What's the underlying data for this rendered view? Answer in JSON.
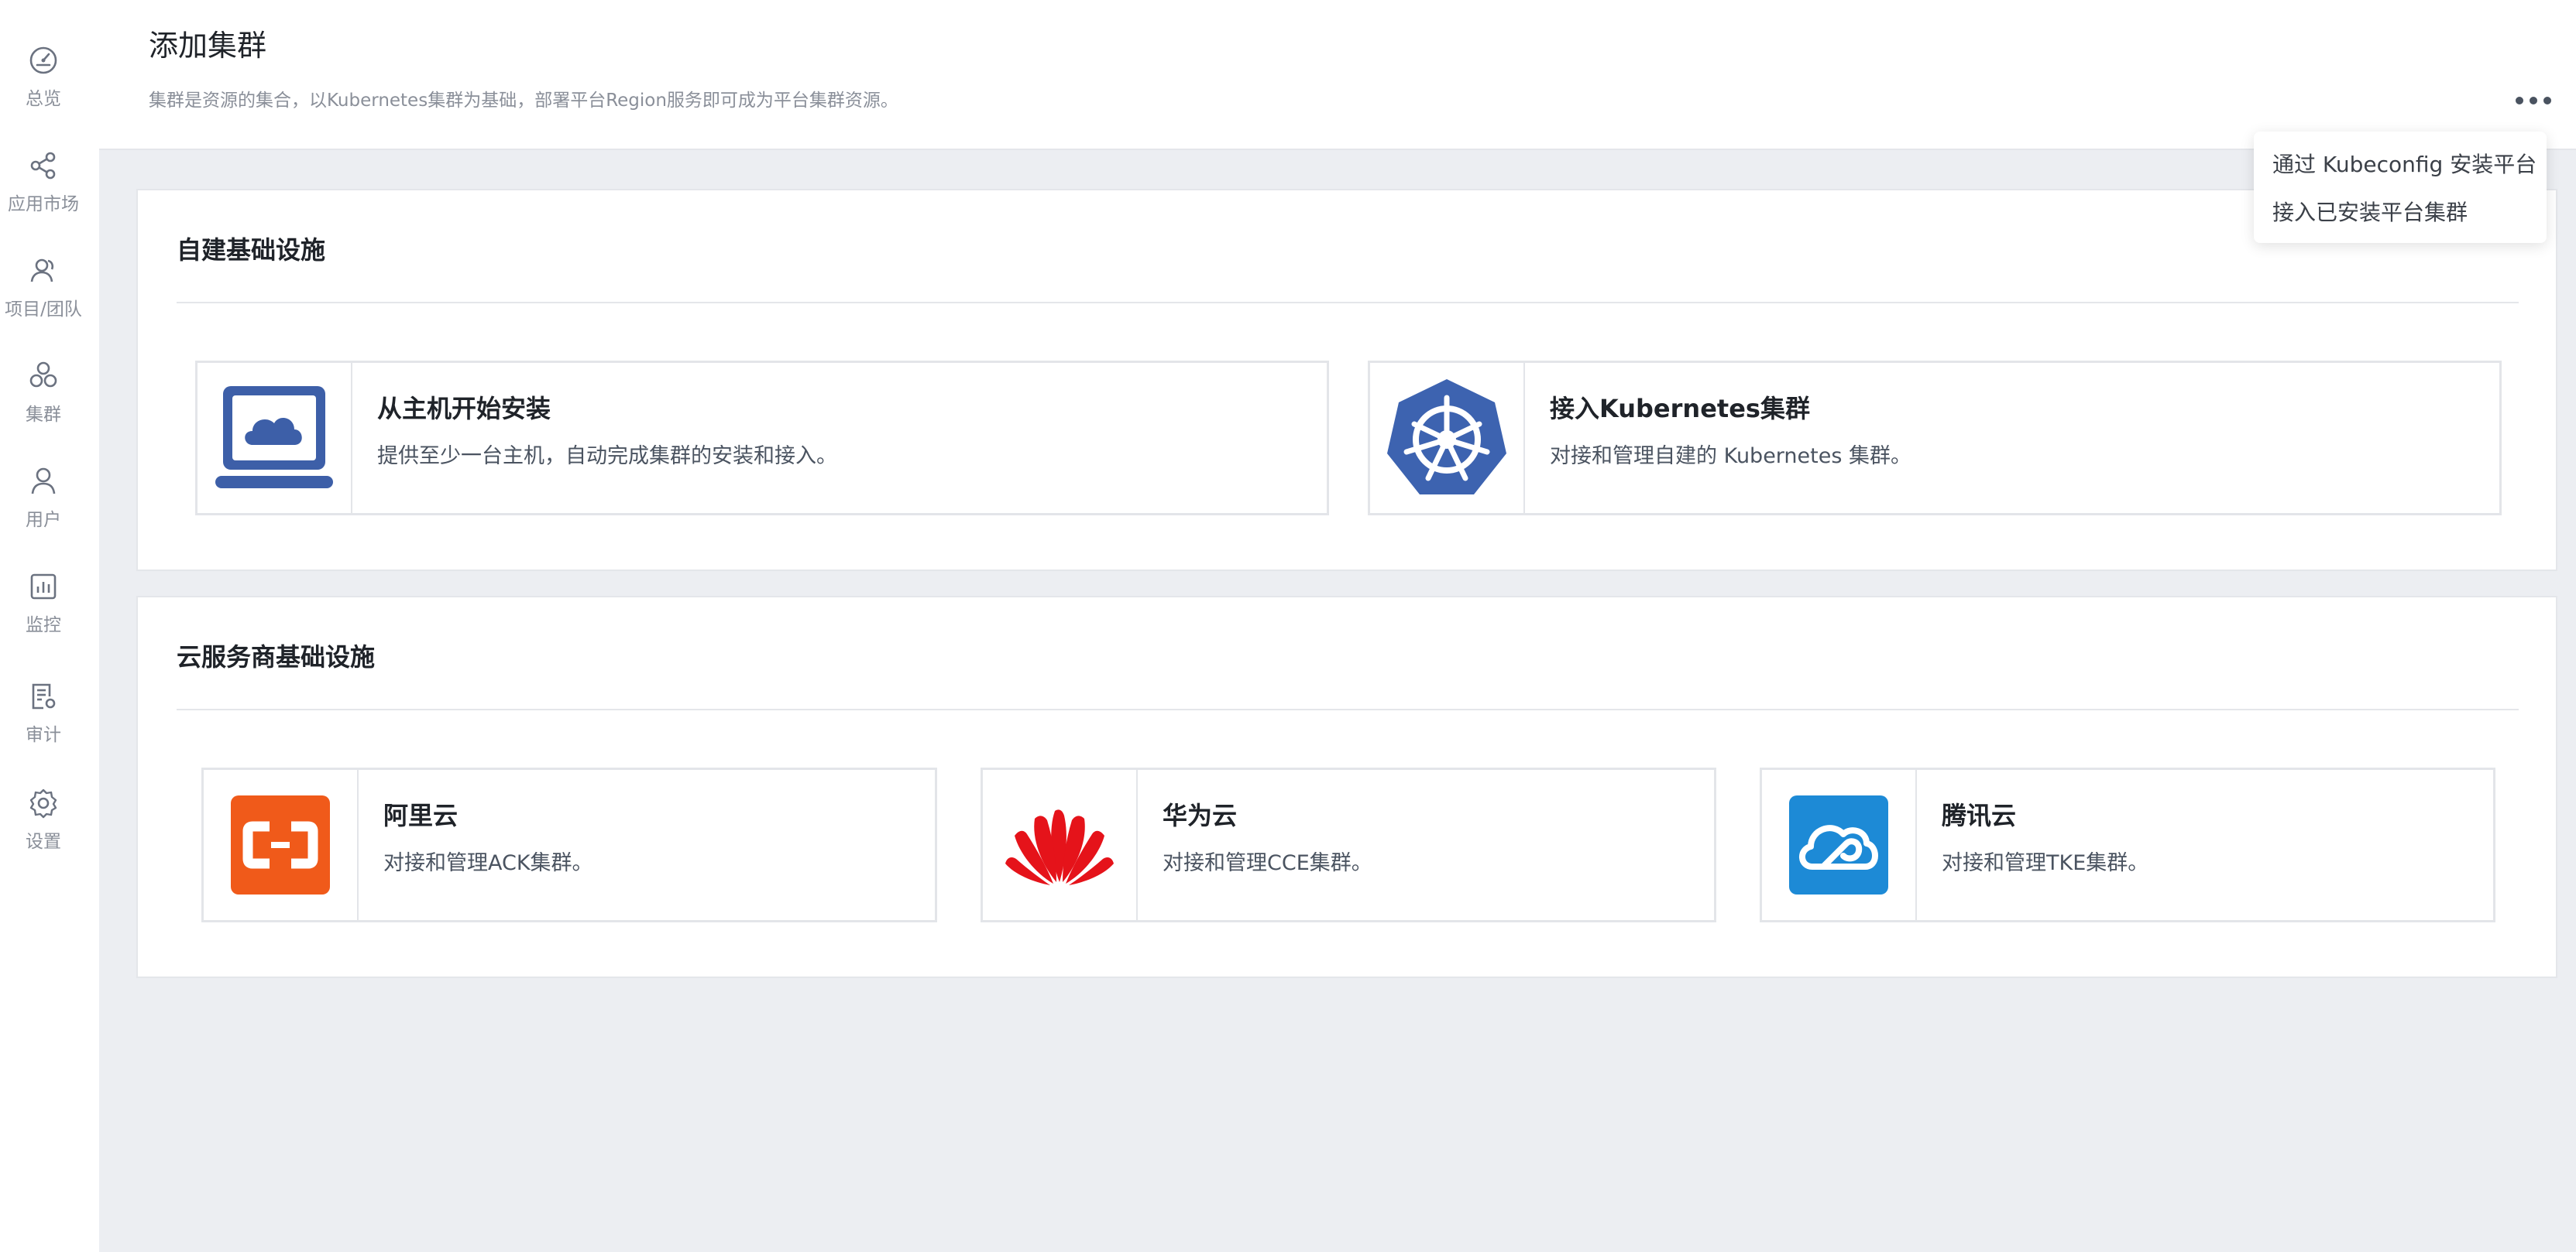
{
  "sidebar": {
    "items": [
      {
        "label": "总览",
        "icon": "dashboard-icon"
      },
      {
        "label": "应用市场",
        "icon": "share-icon"
      },
      {
        "label": "项目/团队",
        "icon": "team-icon"
      },
      {
        "label": "集群",
        "icon": "cluster-icon"
      },
      {
        "label": "用户",
        "icon": "user-icon"
      },
      {
        "label": "监控",
        "icon": "monitor-icon"
      },
      {
        "label": "审计",
        "icon": "audit-icon"
      },
      {
        "label": "设置",
        "icon": "gear-icon"
      }
    ]
  },
  "header": {
    "title": "添加集群",
    "description": "集群是资源的集合，以Kubernetes集群为基础，部署平台Region服务即可成为平台集群资源。"
  },
  "dropdown": {
    "items": [
      {
        "label": "通过 Kubeconfig 安装平台"
      },
      {
        "label": "接入已安装平台集群"
      }
    ]
  },
  "self_built": {
    "title": "自建基础设施",
    "cards": [
      {
        "title": "从主机开始安装",
        "desc": "提供至少一台主机，自动完成集群的安装和接入。",
        "icon": "laptop-cloud-icon"
      },
      {
        "title": "接入Kubernetes集群",
        "desc": "对接和管理自建的 Kubernetes 集群。",
        "icon": "kubernetes-icon"
      }
    ]
  },
  "cloud": {
    "title": "云服务商基础设施",
    "cards": [
      {
        "title": "阿里云",
        "desc": "对接和管理ACK集群。",
        "icon": "aliyun-icon"
      },
      {
        "title": "华为云",
        "desc": "对接和管理CCE集群。",
        "icon": "huawei-icon"
      },
      {
        "title": "腾讯云",
        "desc": "对接和管理TKE集群。",
        "icon": "tencent-cloud-icon"
      }
    ]
  },
  "colors": {
    "background": "#eceef2",
    "kubernetes_blue": "#3d63b0",
    "laptop_blue": "#3d5fa8",
    "aliyun_orange": "#f05a1a",
    "huawei_red": "#e5131a",
    "tencent_blue": "#1d8ad6"
  }
}
